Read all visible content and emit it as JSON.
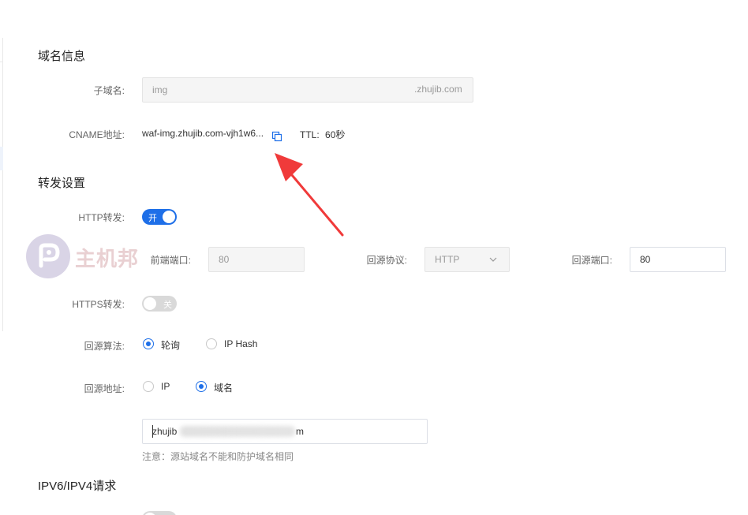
{
  "domain_info": {
    "title": "域名信息",
    "subdomain_label": "子域名:",
    "subdomain_value": "img",
    "subdomain_suffix": ".zhujib.com",
    "cname_label": "CNAME地址:",
    "cname_value": "waf-img.zhujib.com-vjh1w6...",
    "ttl_label": "TTL:",
    "ttl_value": "60秒"
  },
  "forward": {
    "title": "转发设置",
    "http_label": "HTTP转发:",
    "http_switch_text": "开",
    "http_on": true,
    "front_port_label": "前端端口:",
    "front_port_value": "80",
    "origin_protocol_label": "回源协议:",
    "origin_protocol_value": "HTTP",
    "origin_port_label": "回源端口:",
    "origin_port_value": "80",
    "https_label": "HTTPS转发:",
    "https_switch_text": "关",
    "https_on": false,
    "algorithm_label": "回源算法:",
    "algorithm_options": [
      "轮询",
      "IP Hash"
    ],
    "algorithm_selected": "轮询",
    "origin_addr_label": "回源地址:",
    "origin_addr_options": [
      "IP",
      "域名"
    ],
    "origin_addr_selected": "域名",
    "origin_domain_value": "zhujib.oss-cn-qingdao.aliyuncs.com",
    "origin_domain_visible_prefix": "zhujib",
    "origin_domain_visible_suffix": "m",
    "note": "注意：源站域名不能和防护域名相同"
  },
  "ipv": {
    "title": "IPV6/IPV4请求"
  },
  "watermark": {
    "text": "主机邦"
  },
  "colors": {
    "accent": "#1e6fe8",
    "arrow": "#f03a3a",
    "watermark": "#e9d0d2"
  }
}
